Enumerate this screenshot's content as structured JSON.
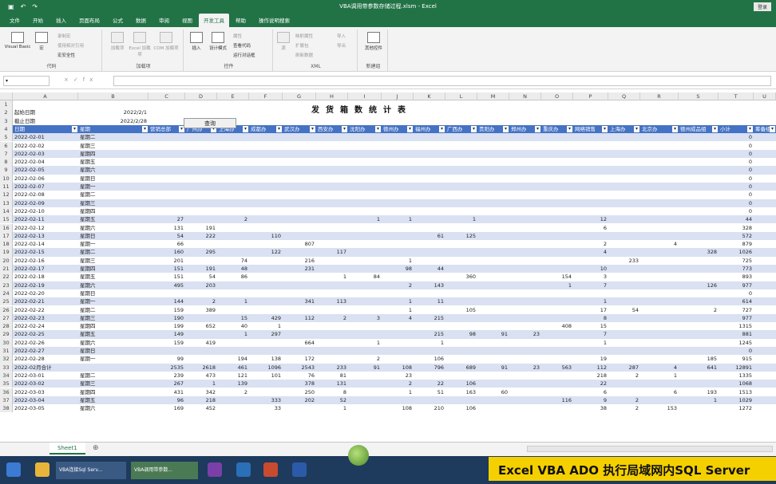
{
  "window": {
    "title": "VBA调用带参数存储过程.xlsm - Excel",
    "login": "登录"
  },
  "tabs": [
    "文件",
    "开始",
    "插入",
    "页面布局",
    "公式",
    "数据",
    "审阅",
    "视图",
    "开发工具",
    "帮助",
    "操作说明搜索"
  ],
  "active_tab": "开发工具",
  "ribbon": {
    "code": {
      "label": "代码",
      "vb": "Visual Basic",
      "macro": "宏",
      "record": "录制宏",
      "relative": "使用相对引用",
      "security": "宏安全性"
    },
    "addins": {
      "label": "加载项",
      "a1": "加载项",
      "a2": "Excel 加载项",
      "a3": "COM 加载项"
    },
    "controls": {
      "label": "控件",
      "insert": "插入",
      "design": "设计模式",
      "props": "属性",
      "viewcode": "查看代码",
      "dialog": "运行对话框"
    },
    "xml": {
      "label": "XML",
      "src": "源",
      "map": "映射属性",
      "ext": "扩展包",
      "refresh": "刷新数据",
      "imp": "导入",
      "exp": "导出"
    },
    "newgroup": {
      "label": "新建组",
      "other": "其他控件"
    }
  },
  "formula_bar": {
    "fx": "fx"
  },
  "columns": [
    "A",
    "B",
    "C",
    "D",
    "E",
    "F",
    "G",
    "H",
    "I",
    "J",
    "K",
    "L",
    "M",
    "N",
    "O",
    "P",
    "Q",
    "R",
    "S",
    "T",
    "U"
  ],
  "sheet": {
    "title": "发货箱数统计表",
    "start_label": "起始日期",
    "start_value": "2022/2/1",
    "end_label": "截止日期",
    "end_value": "2022/2/28",
    "query_button": "查询",
    "headers": [
      "日期",
      "星期",
      "营销总部",
      "广州办",
      "上海办",
      "成都办",
      "武汉办",
      "西安办",
      "沈阳办",
      "德州办",
      "福州办",
      "广西办",
      "贵阳办",
      "郑州办",
      "重庆办",
      "网络销售",
      "上海办",
      "北京办",
      "德州成品组",
      "小计",
      "筹备组"
    ],
    "rows": [
      [
        "2022-02-01",
        "星期二",
        "",
        "",
        "",
        "",
        "",
        "",
        "",
        "",
        "",
        "",
        "",
        "",
        "",
        "",
        "",
        "",
        "",
        "0"
      ],
      [
        "2022-02-02",
        "星期三",
        "",
        "",
        "",
        "",
        "",
        "",
        "",
        "",
        "",
        "",
        "",
        "",
        "",
        "",
        "",
        "",
        "",
        "0"
      ],
      [
        "2022-02-03",
        "星期四",
        "",
        "",
        "",
        "",
        "",
        "",
        "",
        "",
        "",
        "",
        "",
        "",
        "",
        "",
        "",
        "",
        "",
        "0"
      ],
      [
        "2022-02-04",
        "星期五",
        "",
        "",
        "",
        "",
        "",
        "",
        "",
        "",
        "",
        "",
        "",
        "",
        "",
        "",
        "",
        "",
        "",
        "0"
      ],
      [
        "2022-02-05",
        "星期六",
        "",
        "",
        "",
        "",
        "",
        "",
        "",
        "",
        "",
        "",
        "",
        "",
        "",
        "",
        "",
        "",
        "",
        "0"
      ],
      [
        "2022-02-06",
        "星期日",
        "",
        "",
        "",
        "",
        "",
        "",
        "",
        "",
        "",
        "",
        "",
        "",
        "",
        "",
        "",
        "",
        "",
        "0"
      ],
      [
        "2022-02-07",
        "星期一",
        "",
        "",
        "",
        "",
        "",
        "",
        "",
        "",
        "",
        "",
        "",
        "",
        "",
        "",
        "",
        "",
        "",
        "0"
      ],
      [
        "2022-02-08",
        "星期二",
        "",
        "",
        "",
        "",
        "",
        "",
        "",
        "",
        "",
        "",
        "",
        "",
        "",
        "",
        "",
        "",
        "",
        "0"
      ],
      [
        "2022-02-09",
        "星期三",
        "",
        "",
        "",
        "",
        "",
        "",
        "",
        "",
        "",
        "",
        "",
        "",
        "",
        "",
        "",
        "",
        "",
        "0"
      ],
      [
        "2022-02-10",
        "星期四",
        "",
        "",
        "",
        "",
        "",
        "",
        "",
        "",
        "",
        "",
        "",
        "",
        "",
        "",
        "",
        "",
        "",
        "0"
      ],
      [
        "2022-02-11",
        "星期五",
        "27",
        "",
        "2",
        "",
        "",
        "",
        "1",
        "1",
        "",
        "1",
        "",
        "",
        "",
        "12",
        "",
        "",
        "",
        "44"
      ],
      [
        "2022-02-12",
        "星期六",
        "131",
        "191",
        "",
        "",
        "",
        "",
        "",
        "",
        "",
        "",
        "",
        "",
        "",
        "6",
        "",
        "",
        "",
        "328"
      ],
      [
        "2022-02-13",
        "星期日",
        "54",
        "222",
        "",
        "110",
        "",
        "",
        "",
        "",
        "61",
        "125",
        "",
        "",
        "",
        "",
        "",
        "",
        "",
        "572"
      ],
      [
        "2022-02-14",
        "星期一",
        "66",
        "",
        "",
        "",
        "807",
        "",
        "",
        "",
        "",
        "",
        "",
        "",
        "",
        "2",
        "",
        "4",
        "",
        "879"
      ],
      [
        "2022-02-15",
        "星期二",
        "160",
        "295",
        "",
        "122",
        "",
        "117",
        "",
        "",
        "",
        "",
        "",
        "",
        "",
        "4",
        "",
        "",
        "328",
        "1026"
      ],
      [
        "2022-02-16",
        "星期三",
        "201",
        "",
        "74",
        "",
        "216",
        "",
        "",
        "1",
        "",
        "",
        "",
        "",
        "",
        "",
        "233",
        "",
        "",
        "725"
      ],
      [
        "2022-02-17",
        "星期四",
        "151",
        "191",
        "48",
        "",
        "231",
        "",
        "",
        "98",
        "44",
        "",
        "",
        "",
        "",
        "10",
        "",
        "",
        "",
        "773"
      ],
      [
        "2022-02-18",
        "星期五",
        "151",
        "54",
        "86",
        "",
        "",
        "1",
        "84",
        "",
        "",
        "360",
        "",
        "",
        "154",
        "3",
        "",
        "",
        "",
        "893"
      ],
      [
        "2022-02-19",
        "星期六",
        "495",
        "203",
        "",
        "",
        "",
        "",
        "",
        "2",
        "143",
        "",
        "",
        "",
        "1",
        "7",
        "",
        "",
        "126",
        "977"
      ],
      [
        "2022-02-20",
        "星期日",
        "",
        "",
        "",
        "",
        "",
        "",
        "",
        "",
        "",
        "",
        "",
        "",
        "",
        "",
        "",
        "",
        "",
        "0"
      ],
      [
        "2022-02-21",
        "星期一",
        "144",
        "2",
        "1",
        "",
        "341",
        "113",
        "",
        "1",
        "11",
        "",
        "",
        "",
        "",
        "1",
        "",
        "",
        "",
        "614"
      ],
      [
        "2022-02-22",
        "星期二",
        "159",
        "389",
        "",
        "",
        "",
        "",
        "",
        "1",
        "",
        "105",
        "",
        "",
        "",
        "17",
        "54",
        "",
        "2",
        "727"
      ],
      [
        "2022-02-23",
        "星期三",
        "190",
        "",
        "15",
        "429",
        "112",
        "2",
        "3",
        "4",
        "215",
        "",
        "",
        "",
        "",
        "8",
        "",
        "",
        "",
        "977"
      ],
      [
        "2022-02-24",
        "星期四",
        "199",
        "652",
        "40",
        "1",
        "",
        "",
        "",
        "",
        "",
        "",
        "",
        "",
        "408",
        "15",
        "",
        "",
        "",
        "1315"
      ],
      [
        "2022-02-25",
        "星期五",
        "149",
        "",
        "1",
        "297",
        "",
        "",
        "",
        "",
        "215",
        "98",
        "91",
        "23",
        "",
        "7",
        "",
        "",
        "",
        "881"
      ],
      [
        "2022-02-26",
        "星期六",
        "159",
        "419",
        "",
        "",
        "664",
        "",
        "1",
        "",
        "1",
        "",
        "",
        "",
        "",
        "1",
        "",
        "",
        "",
        "1245"
      ],
      [
        "2022-02-27",
        "星期日",
        "",
        "",
        "",
        "",
        "",
        "",
        "",
        "",
        "",
        "",
        "",
        "",
        "",
        "",
        "",
        "",
        "",
        "0"
      ],
      [
        "2022-02-28",
        "星期一",
        "99",
        "",
        "194",
        "138",
        "172",
        "",
        "2",
        "",
        "106",
        "",
        "",
        "",
        "",
        "19",
        "",
        "",
        "185",
        "915"
      ],
      [
        "2022-02月合计",
        "",
        "2535",
        "2618",
        "461",
        "1096",
        "2543",
        "233",
        "91",
        "108",
        "796",
        "689",
        "91",
        "23",
        "563",
        "112",
        "287",
        "4",
        "641",
        "12891"
      ],
      [
        "2022-03-01",
        "星期二",
        "239",
        "473",
        "121",
        "101",
        "76",
        "81",
        "",
        "23",
        "",
        "",
        "",
        "",
        "",
        "218",
        "2",
        "1",
        "",
        "1335"
      ],
      [
        "2022-03-02",
        "星期三",
        "267",
        "1",
        "139",
        "",
        "378",
        "131",
        "",
        "2",
        "22",
        "106",
        "",
        "",
        "",
        "22",
        "",
        "",
        "",
        "1068"
      ],
      [
        "2022-03-03",
        "星期四",
        "431",
        "342",
        "2",
        "",
        "250",
        "8",
        "",
        "1",
        "51",
        "163",
        "60",
        "",
        "",
        "6",
        "",
        "6",
        "193",
        "1513"
      ],
      [
        "2022-03-04",
        "星期五",
        "96",
        "218",
        "",
        "333",
        "202",
        "52",
        "",
        "",
        "",
        "",
        "",
        "",
        "116",
        "9",
        "2",
        "",
        "1",
        "1029"
      ],
      [
        "2022-03-05",
        "星期六",
        "169",
        "452",
        "",
        "33",
        "",
        "1",
        "",
        "108",
        "210",
        "106",
        "",
        "",
        "",
        "38",
        "2",
        "153",
        "",
        "1272"
      ]
    ]
  },
  "sheet_tab": "Sheet1",
  "taskbar": {
    "items": [
      "VBA连接Sql Serv...",
      "VBA调用带参数..."
    ]
  },
  "subtitle": "Excel VBA ADO 执行局域网内SQL Server"
}
